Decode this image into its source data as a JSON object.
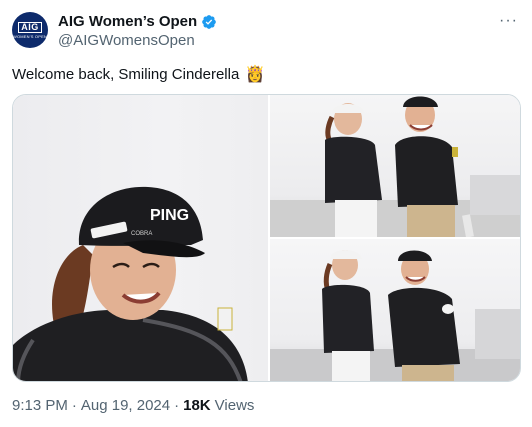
{
  "account": {
    "avatar_text": "AIG",
    "avatar_sub": "WOMEN'S OPEN",
    "display_name": "AIG Women’s Open",
    "handle": "@AIGWomensOpen"
  },
  "tweet": {
    "text": "Welcome back, Smiling Cinderella",
    "emoji": "👸"
  },
  "meta": {
    "time": "9:13 PM",
    "separator": "·",
    "date": "Aug 19, 2024",
    "separator2": "·",
    "views_count": "18K",
    "views_label": "Views"
  },
  "icons": {
    "verified": "verified-badge-icon",
    "more": "more-options-icon"
  },
  "colors": {
    "verified_blue": "#1d9bf0",
    "avatar_navy": "#0d2a6b",
    "secondary_text": "#536471"
  }
}
